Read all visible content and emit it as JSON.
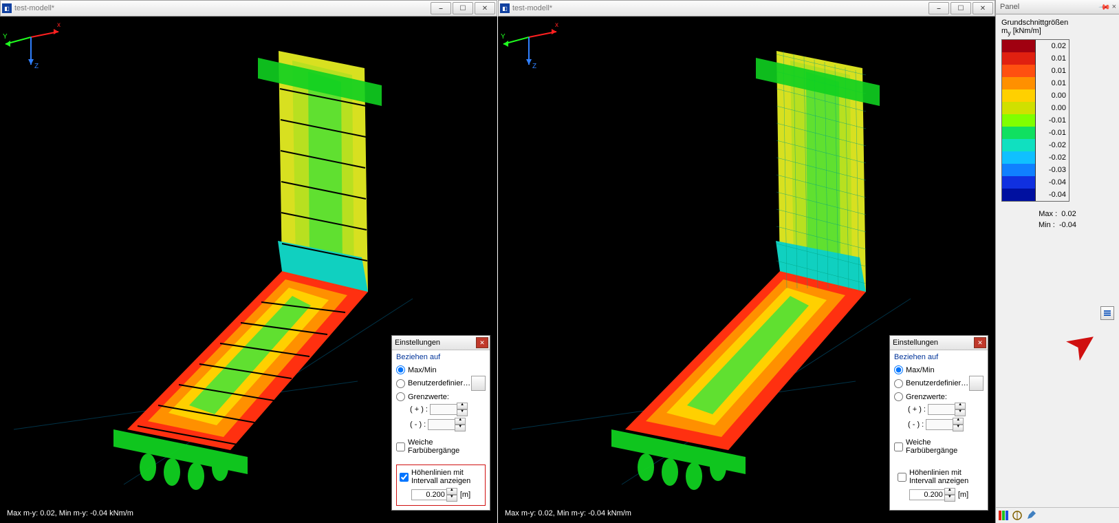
{
  "windows": [
    {
      "title": "test-modell*"
    },
    {
      "title": "test-modell*"
    }
  ],
  "status_text": "Max m-y: 0.02, Min m-y: -0.04 kNm/m",
  "axis": {
    "x": "x",
    "y": "Y",
    "z": "Z"
  },
  "settings": {
    "title": "Einstellungen",
    "group": "Beziehen auf",
    "opt_maxmin": "Max/Min",
    "opt_custom": "Benutzerdefinierte..",
    "opt_limits": "Grenzwerte:",
    "plus_label": "( + ) :",
    "minus_label": "( - ) :",
    "smooth_label": "Weiche Farbübergänge",
    "iso_label": "Höhenlinien mit Intervall anzeigen",
    "iso_value": "0.200",
    "iso_unit": "[m]"
  },
  "panel": {
    "title": "Panel",
    "legend_title": "Grundschnittgrößen",
    "legend_sub": "m",
    "legend_sub_idx": "y",
    "legend_unit": " [kNm/m]",
    "rows": [
      {
        "c": "#a00010",
        "v": "0.02"
      },
      {
        "c": "#e02010",
        "v": "0.01"
      },
      {
        "c": "#ff5010",
        "v": "0.01"
      },
      {
        "c": "#ff9000",
        "v": "0.01"
      },
      {
        "c": "#ffd000",
        "v": "0.00"
      },
      {
        "c": "#d0e000",
        "v": "0.00"
      },
      {
        "c": "#80ff00",
        "v": "-0.01"
      },
      {
        "c": "#10e060",
        "v": "-0.01"
      },
      {
        "c": "#10e0c0",
        "v": "-0.02"
      },
      {
        "c": "#10c0ff",
        "v": "-0.02"
      },
      {
        "c": "#1080ff",
        "v": "-0.03"
      },
      {
        "c": "#1030e0",
        "v": "-0.04"
      },
      {
        "c": "#0010a0",
        "v": "-0.04"
      }
    ],
    "max_label": "Max :",
    "max_val": "0.02",
    "min_label": "Min :",
    "min_val": "-0.04"
  }
}
